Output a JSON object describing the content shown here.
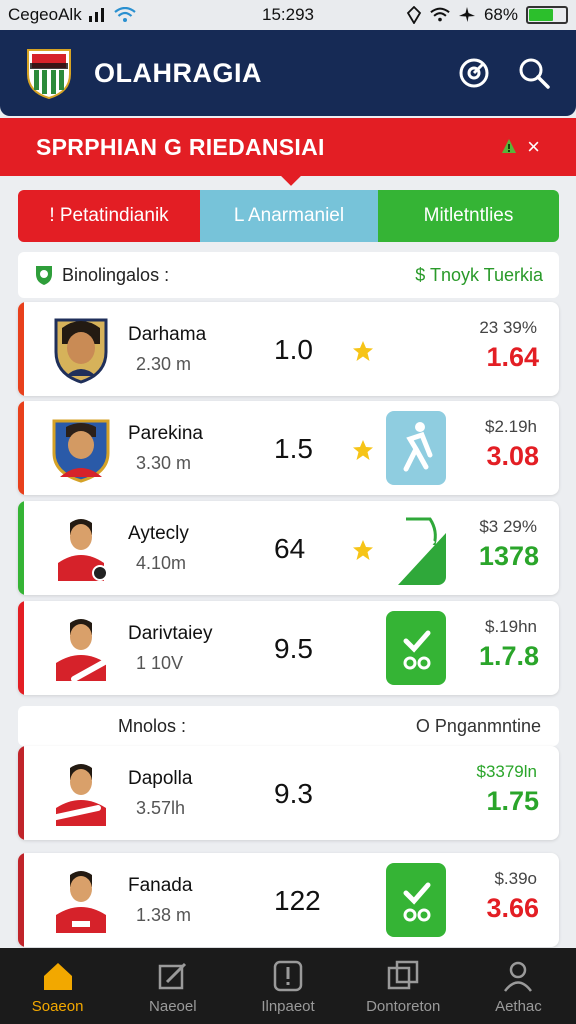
{
  "status_bar": {
    "carrier": "CegeoAlk",
    "time": "15:293",
    "battery": "68%",
    "battery_level": 0.68
  },
  "header": {
    "title": "OLAHRAGIA"
  },
  "banner": {
    "title": "SPRPHIAN G RIEDANSIAI",
    "close": "×"
  },
  "tabs": [
    {
      "label": "! Petatindianik"
    },
    {
      "label": "L Anarmaniel"
    },
    {
      "label": "Mitletntlies"
    }
  ],
  "section1": {
    "title": "Binolingalos :",
    "right": "$ Tnoyk Tuerkia"
  },
  "section2": {
    "title": "Mnolos :",
    "right": "O Pnganmntine"
  },
  "players": [
    {
      "name": "Darhama",
      "distance": "2.30 m",
      "score": "1.0",
      "small": "23 39%",
      "big": "1.64",
      "big_color": "#e31e24",
      "accent": "#e8401c",
      "star": true,
      "tile": "none",
      "avatar": "portrait"
    },
    {
      "name": "Parekina",
      "distance": "3.30 m",
      "score": "1.5",
      "small": "$2.19h",
      "big": "3.08",
      "big_color": "#e31e24",
      "accent": "#e8401c",
      "star": true,
      "tile": "blue",
      "avatar": "badge"
    },
    {
      "name": "Aytecly",
      "distance": "4.10m",
      "score": "64",
      "small": "$3 29%",
      "big": "1378",
      "big_color": "#2aa52a",
      "accent": "#35b435",
      "star": true,
      "tile": "chart",
      "avatar": "player"
    },
    {
      "name": "Darivtaiey",
      "distance": "1 10V",
      "score": "9.5",
      "small": "$.19hn",
      "big": "1.7.8",
      "big_color": "#2aa52a",
      "accent": "#e31e24",
      "star": false,
      "tile": "green",
      "avatar": "player"
    },
    {
      "name": "Dapolla",
      "distance": "3.57lh",
      "score": "9.3",
      "small": "$3379ln",
      "big": "1.75",
      "big_color": "#2aa52a",
      "accent": "#c0242a",
      "star": false,
      "tile": "none",
      "avatar": "player"
    },
    {
      "name": "Fanada",
      "distance": "1.38 m",
      "score": "122",
      "small": "$.39o",
      "big": "3.66",
      "big_color": "#e31e24",
      "accent": "#c0242a",
      "star": false,
      "tile": "green",
      "avatar": "player"
    }
  ],
  "nav": [
    {
      "label": "Soaeon",
      "icon": "home-icon",
      "active": true
    },
    {
      "label": "Naeoel",
      "icon": "edit-icon",
      "active": false
    },
    {
      "label": "Ilnpaeot",
      "icon": "alert-icon",
      "active": false
    },
    {
      "label": "Dontoreton",
      "icon": "cards-icon",
      "active": false
    },
    {
      "label": "Aethac",
      "icon": "profile-icon",
      "active": false
    }
  ],
  "colors": {
    "header_bg": "#162a55",
    "banner_bg": "#e31e24",
    "tab_red": "#e31e24",
    "tab_blue": "#77c3d9",
    "tab_green": "#35b435",
    "active_nav": "#f2a800"
  }
}
